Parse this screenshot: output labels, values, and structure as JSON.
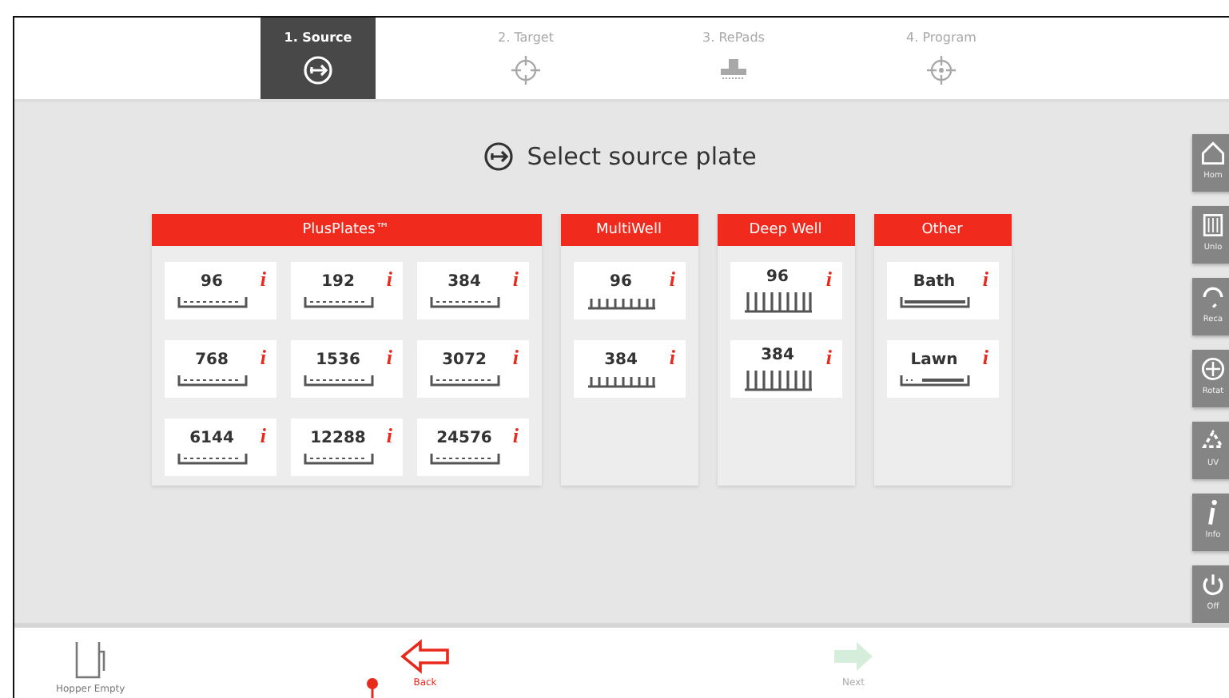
{
  "steps": [
    {
      "label": "1. Source",
      "selected": true
    },
    {
      "label": "2. Target",
      "selected": false
    },
    {
      "label": "3. RePads",
      "selected": false
    },
    {
      "label": "4. Program",
      "selected": false
    }
  ],
  "heading": "Select source plate",
  "groups": [
    {
      "title": "PlusPlates™",
      "items": [
        {
          "label": "96",
          "kind": "flat",
          "info": "i"
        },
        {
          "label": "192",
          "kind": "flat",
          "info": "i"
        },
        {
          "label": "384",
          "kind": "flat",
          "info": "i"
        },
        {
          "label": "768",
          "kind": "flat",
          "info": "i"
        },
        {
          "label": "1536",
          "kind": "flat",
          "info": "i"
        },
        {
          "label": "3072",
          "kind": "flat",
          "info": "i"
        },
        {
          "label": "6144",
          "kind": "flat",
          "info": "i"
        },
        {
          "label": "12288",
          "kind": "flat",
          "info": "i"
        },
        {
          "label": "24576",
          "kind": "flat",
          "info": "i"
        }
      ]
    },
    {
      "title": "MultiWell",
      "items": [
        {
          "label": "96",
          "kind": "multi",
          "info": "i"
        },
        {
          "label": "384",
          "kind": "multi",
          "info": "i"
        }
      ]
    },
    {
      "title": "Deep Well",
      "items": [
        {
          "label": "96",
          "kind": "deep",
          "info": "i"
        },
        {
          "label": "384",
          "kind": "deep",
          "info": "i"
        }
      ]
    },
    {
      "title": "Other",
      "items": [
        {
          "label": "Bath",
          "kind": "bath",
          "info": "i"
        },
        {
          "label": "Lawn",
          "kind": "lawn",
          "info": "i"
        }
      ]
    }
  ],
  "side_buttons": [
    {
      "label": "Hom"
    },
    {
      "label": "Unlo"
    },
    {
      "label": "Reca"
    },
    {
      "label": "Rotat"
    },
    {
      "label": "UV"
    },
    {
      "label": "Info"
    },
    {
      "label": "Off"
    }
  ],
  "bottom": [
    {
      "label": "Hopper Empty",
      "kind": "hopper",
      "disabled": false
    },
    {
      "label": "Back",
      "kind": "back",
      "disabled": false
    },
    {
      "label": "Next",
      "kind": "next",
      "disabled": true
    }
  ]
}
